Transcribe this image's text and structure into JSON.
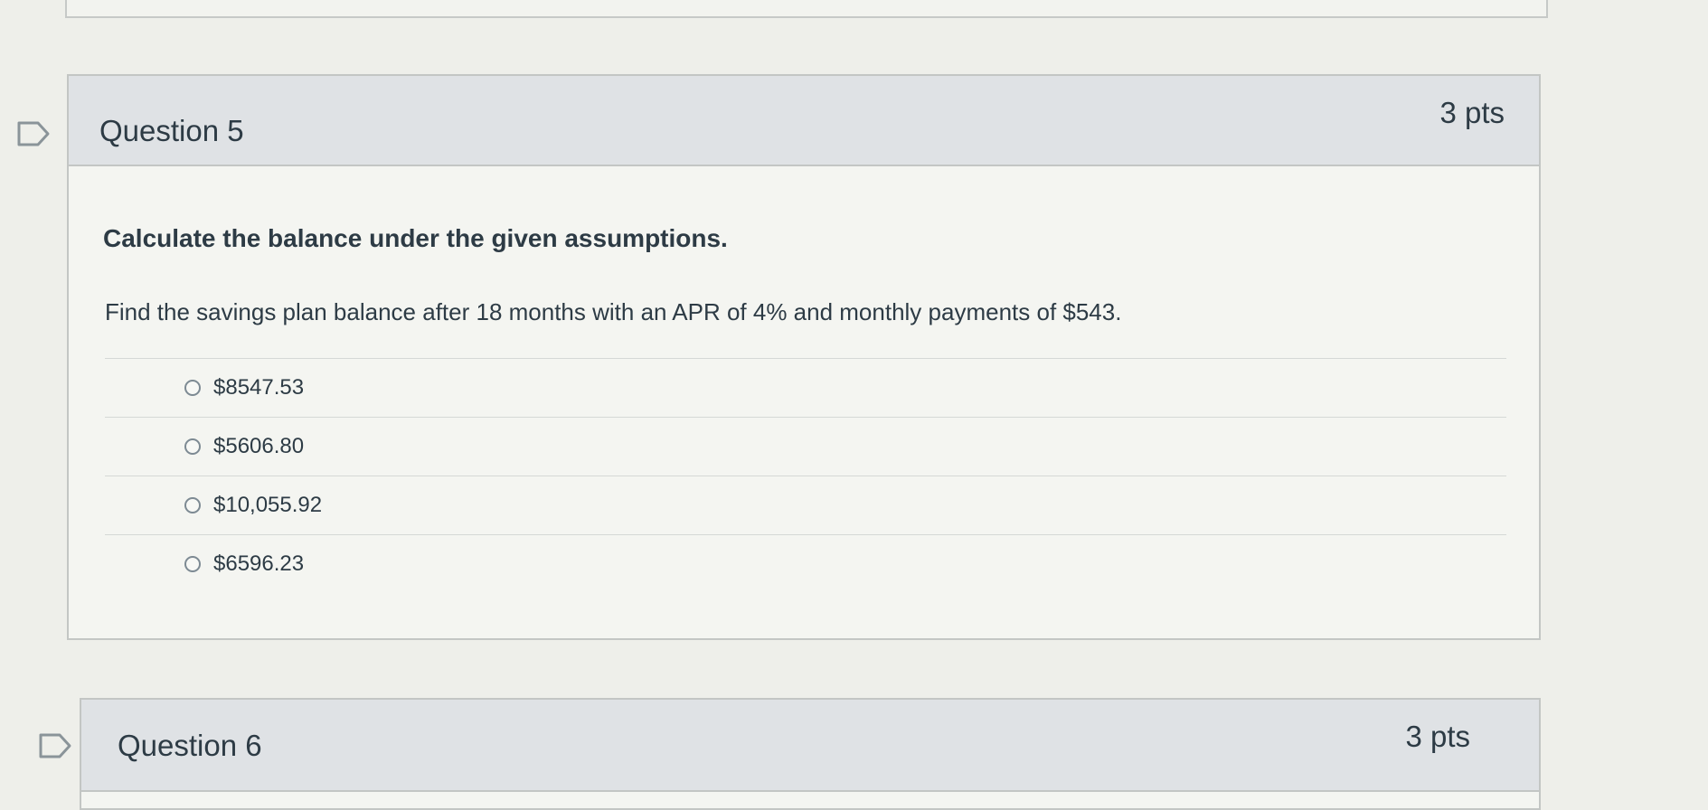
{
  "question5": {
    "title": "Question 5",
    "points": "3 pts",
    "instruction": "Calculate the balance under the given assumptions.",
    "prompt": "Find the savings plan balance after 18 months with an APR of 4% and monthly payments of $543.",
    "answers": [
      {
        "label": "$8547.53"
      },
      {
        "label": "$5606.80"
      },
      {
        "label": "$10,055.92"
      },
      {
        "label": "$6596.23"
      }
    ]
  },
  "question6": {
    "title": "Question 6",
    "points": "3 pts"
  },
  "icons": {
    "flag": "flag-question-icon"
  },
  "colors": {
    "text": "#2d3b45",
    "header_bg": "#dfe2e5",
    "border": "#c3c6c4"
  }
}
